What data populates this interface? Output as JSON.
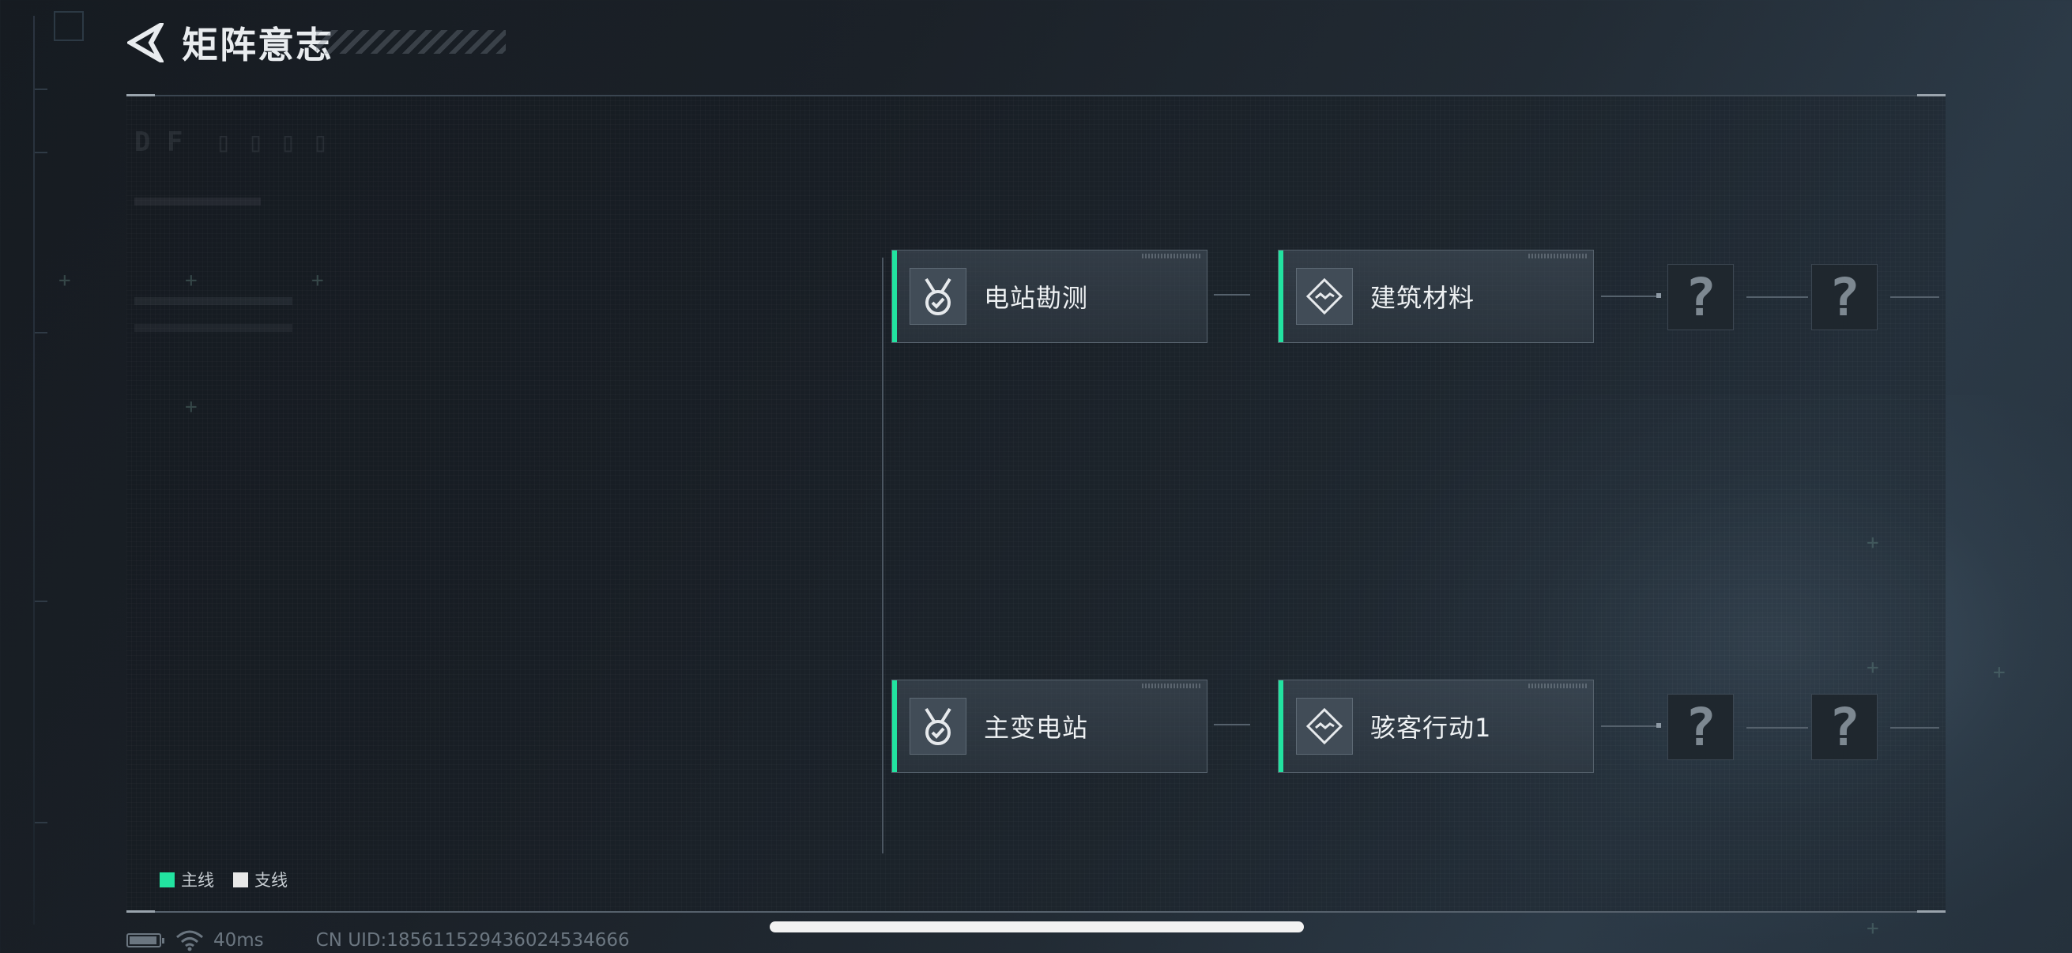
{
  "header": {
    "title": "矩阵意志",
    "back_icon": "back-arrow-icon"
  },
  "legend": [
    {
      "label": "主线",
      "color": "#22e3a0"
    },
    {
      "label": "支线",
      "color": "#e8e8e8"
    }
  ],
  "rows": [
    {
      "nodes": [
        {
          "label": "电站勘测",
          "icon": "medal-check-icon"
        },
        {
          "label": "建筑材料",
          "icon": "diamond-chip-icon"
        }
      ],
      "locked": [
        "?",
        "?"
      ]
    },
    {
      "nodes": [
        {
          "label": "主变电站",
          "icon": "medal-check-icon"
        },
        {
          "label": "骇客行动1",
          "icon": "diamond-chip-icon"
        }
      ],
      "locked": [
        "?",
        "?"
      ]
    }
  ],
  "status": {
    "ping": "40ms",
    "uid": "CN UID:1856115294360245346​66"
  },
  "colors": {
    "main_line": "#22e3a0",
    "accent_bg": "#1b2128"
  }
}
